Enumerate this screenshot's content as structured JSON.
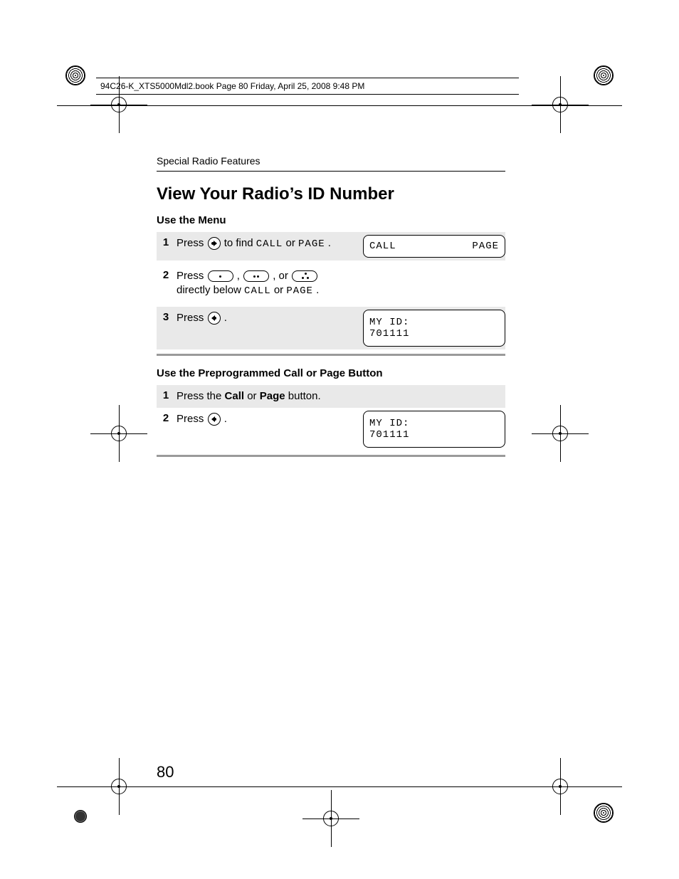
{
  "header_line": "94C26-K_XTS5000Mdl2.book  Page 80  Friday, April 25, 2008  9:48 PM",
  "section_label": "Special Radio Features",
  "title": "View Your Radio’s ID Number",
  "page_number": "80",
  "menu": {
    "subtitle": "Use the Menu",
    "steps": {
      "s1": {
        "num": "1",
        "press": "Press ",
        "mid": " to find ",
        "t1": "CALL",
        "or": " or ",
        "t2": "PAGE",
        "end": ".",
        "lcd_left": "CALL",
        "lcd_right": "PAGE"
      },
      "s2": {
        "num": "2",
        "press": "Press ",
        "comma1": ", ",
        "comma2": ", or ",
        "line2a": "directly below ",
        "t1": "CALL",
        "or": " or ",
        "t2": "PAGE",
        "end": "."
      },
      "s3": {
        "num": "3",
        "press": "Press ",
        "end": ".",
        "lcd_l1": "MY ID:",
        "lcd_l2": "701111"
      }
    }
  },
  "preprog": {
    "subtitle": "Use the Preprogrammed Call or Page Button",
    "steps": {
      "s1": {
        "num": "1",
        "a": "Press the ",
        "b": "Call",
        "c": " or ",
        "d": "Page",
        "e": " button."
      },
      "s2": {
        "num": "2",
        "press": "Press ",
        "end": ".",
        "lcd_l1": "MY ID:",
        "lcd_l2": "701111"
      }
    }
  }
}
